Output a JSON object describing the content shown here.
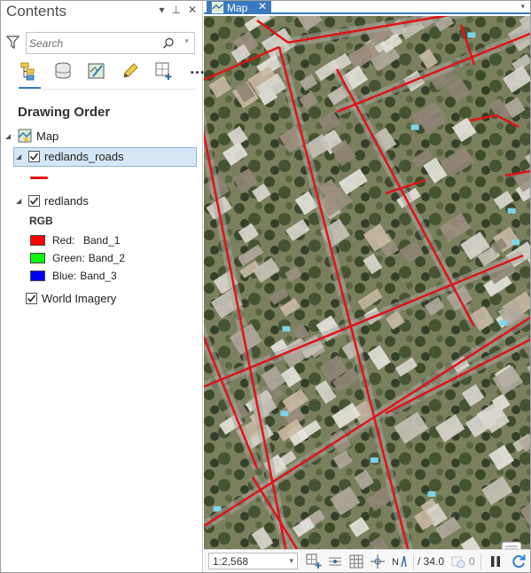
{
  "contents": {
    "title": "Contents",
    "controls": {
      "dropdown": "▾",
      "pin": "⊥",
      "close": "✕"
    },
    "search": {
      "placeholder": "Search",
      "value": ""
    },
    "toolbar": [
      "list-by-drawing-order-icon",
      "list-by-source-icon",
      "list-by-selection-icon",
      "list-by-editing-icon",
      "list-by-snapping-icon"
    ],
    "more_label": "…",
    "section_heading": "Drawing Order",
    "map_label": "Map",
    "layers": {
      "roads": {
        "label": "redlands_roads",
        "checked": true,
        "symbol_color": "#e01414"
      },
      "redlands": {
        "label": "redlands",
        "checked": true,
        "rgb_label": "RGB",
        "bands": [
          {
            "channel": "Red:",
            "band": "Band_1",
            "color": "#ff0000"
          },
          {
            "channel": "Green:",
            "band": "Band_2",
            "color": "#00ff00"
          },
          {
            "channel": "Blue:",
            "band": "Band_3",
            "color": "#0000ff"
          }
        ]
      },
      "imagery": {
        "label": "World Imagery",
        "checked": true
      }
    }
  },
  "map_view": {
    "tab_label": "Map",
    "road_color": "#e01414",
    "status": {
      "scale": "1:2,568",
      "coordinate": "34.0",
      "selected_count": "0"
    }
  },
  "colors": {
    "accent": "#3a7abf",
    "selection": "#d5e6f5"
  }
}
